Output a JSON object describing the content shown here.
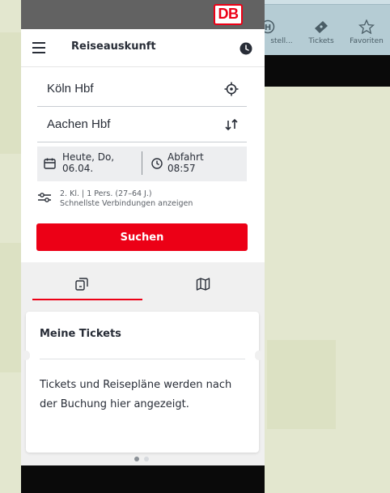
{
  "status_bar": {
    "logo_text": "DB",
    "brand_color": "#ec0016"
  },
  "header": {
    "title": "Reiseauskunft"
  },
  "search_form": {
    "from": "Köln Hbf",
    "to": "Aachen Hbf",
    "date_line1": "Heute, Do,",
    "date_line2": "06.04.",
    "time_label": "Abfahrt",
    "time_value": "08:57",
    "options_line1": "2. Kl. | 1 Pers. (27–64 J.)",
    "options_line2": "Schnellste Verbindungen anzeigen",
    "search_button": "Suchen"
  },
  "tabs": [
    {
      "icon": "tickets-icon",
      "selected": true
    },
    {
      "icon": "map-icon",
      "selected": false
    }
  ],
  "tickets_card": {
    "title": "Meine Tickets",
    "message": "Tickets und Reisepläne werden nach der Buchung hier angezeigt."
  },
  "pager": {
    "count": 2,
    "active": 1
  },
  "background_app_nav": [
    {
      "icon": "bahnhof-icon",
      "label": "stell..."
    },
    {
      "icon": "ticket-icon",
      "label": "Tickets"
    },
    {
      "icon": "star-icon",
      "label": "Favoriten"
    }
  ]
}
